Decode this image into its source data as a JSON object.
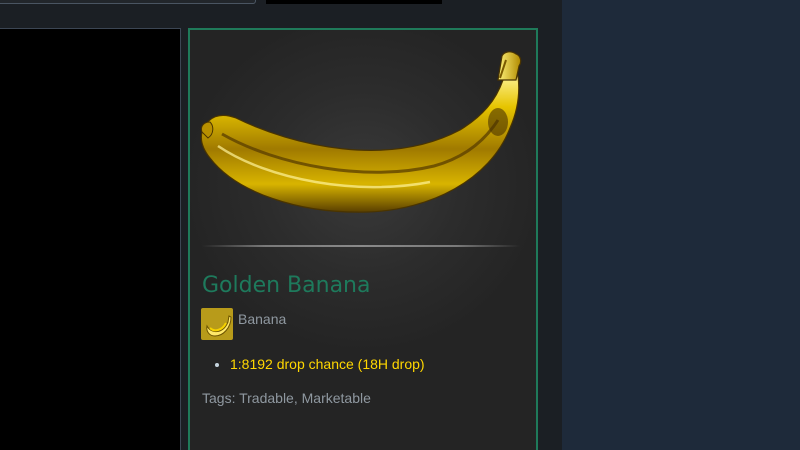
{
  "item": {
    "name": "Golden Banana",
    "game": "Banana",
    "descriptions": [
      "1:8192 drop chance (18H drop)"
    ],
    "tags_label": "Tags:",
    "tags_value": "Tradable, Marketable"
  },
  "colors": {
    "background": "#1b2838",
    "item_name": "#1e7a5c",
    "panel_border": "#1f7a5a",
    "description": "#ffd700",
    "muted_text": "#8f98a0"
  }
}
